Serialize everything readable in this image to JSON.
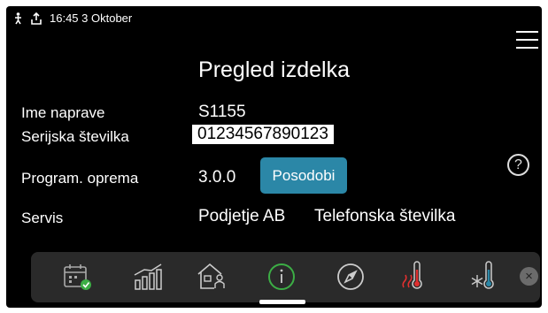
{
  "status": {
    "time": "16:45 3 Oktober"
  },
  "title": "Pregled izdelka",
  "rows": [
    {
      "label": "Ime naprave",
      "value": "S1155"
    },
    {
      "label": "Serijska številka",
      "value": "01234567890123"
    },
    {
      "label": "Program. oprema",
      "value": "3.0.0"
    },
    {
      "label": "Servis",
      "value": "Podjetje AB",
      "value2": "Telefonska številka"
    }
  ],
  "update_button": "Posodobi",
  "help": "?",
  "dock": {
    "items": [
      "calendar-check-icon",
      "bar-chart-icon",
      "house-person-icon",
      "info-icon",
      "compass-icon",
      "heating-thermometer-icon",
      "cooling-thermometer-icon"
    ],
    "close": "×"
  }
}
